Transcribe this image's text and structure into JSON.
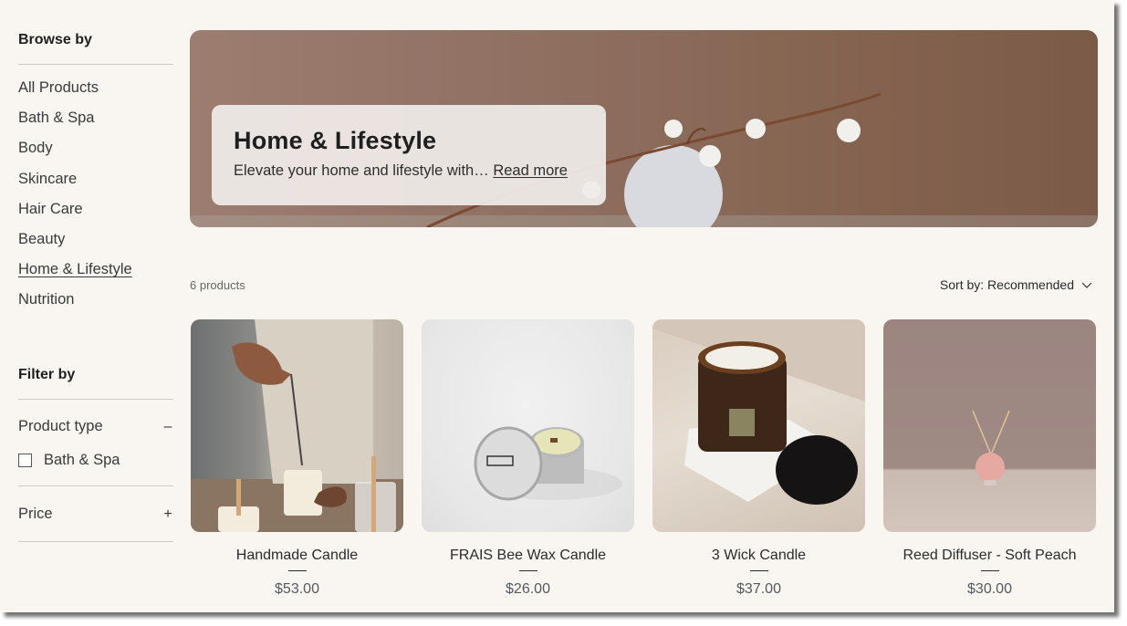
{
  "sidebar": {
    "browse_heading": "Browse by",
    "categories": [
      {
        "label": "All Products",
        "active": false
      },
      {
        "label": "Bath & Spa",
        "active": false
      },
      {
        "label": "Body",
        "active": false
      },
      {
        "label": "Skincare",
        "active": false
      },
      {
        "label": "Hair Care",
        "active": false
      },
      {
        "label": "Beauty",
        "active": false
      },
      {
        "label": "Home & Lifestyle",
        "active": true
      },
      {
        "label": "Nutrition",
        "active": false
      }
    ],
    "filter_heading": "Filter by",
    "filters": {
      "product_type": {
        "label": "Product type",
        "toggle": "–",
        "expanded": true,
        "options": [
          {
            "label": "Bath & Spa",
            "checked": false
          }
        ]
      },
      "price": {
        "label": "Price",
        "toggle": "+",
        "expanded": false
      }
    }
  },
  "hero": {
    "title": "Home & Lifestyle",
    "description": "Elevate your home and lifestyle with…",
    "read_more": "Read more",
    "image": "cotton-branch-image"
  },
  "toolbar": {
    "count": "6 products",
    "sort_label": "Sort by: Recommended",
    "sort_icon": "chevron-down-icon"
  },
  "products": [
    {
      "name": "Handmade Candle",
      "price": "$53.00",
      "image": "candle-making-image"
    },
    {
      "name": "FRAIS Bee Wax Candle",
      "price": "$26.00",
      "image": "tin-candle-image"
    },
    {
      "name": "3 Wick Candle",
      "price": "$37.00",
      "image": "amber-jar-candle-image"
    },
    {
      "name": "Reed Diffuser - Soft Peach",
      "price": "$30.00",
      "image": "reed-diffuser-image"
    }
  ],
  "colors": {
    "page_bg": "#f9f6f2",
    "hero_bg": "#8f6f60",
    "text": "#2b2b2b",
    "price": "#55595f"
  }
}
